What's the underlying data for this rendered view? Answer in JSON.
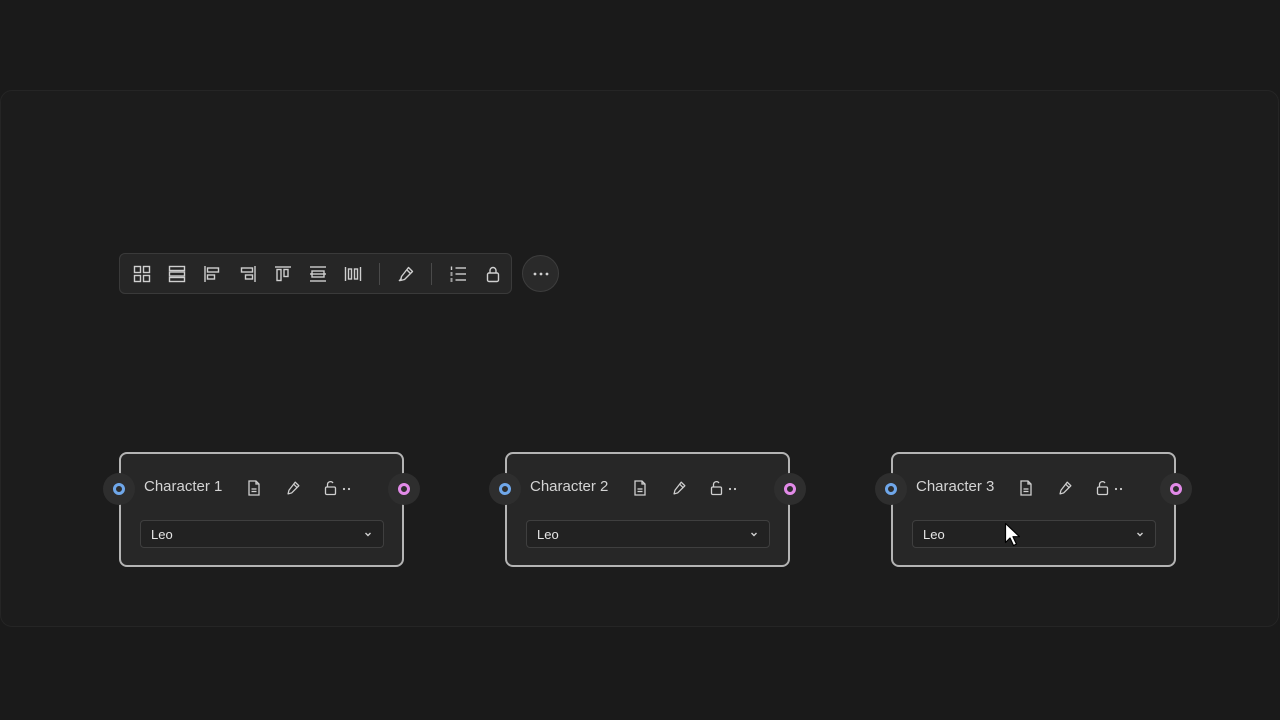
{
  "toolbar": {
    "buttons": [
      {
        "icon": "grid-icon"
      },
      {
        "icon": "rows-icon"
      },
      {
        "icon": "align-left-icon"
      },
      {
        "icon": "align-right-icon"
      },
      {
        "icon": "align-top-icon"
      },
      {
        "icon": "align-vertical-center-icon"
      },
      {
        "icon": "distribute-horizontal-icon"
      },
      {
        "icon": "pen-icon"
      },
      {
        "icon": "numbered-list-icon"
      },
      {
        "icon": "lock-icon"
      }
    ],
    "more_icon": "more-horizontal-icon"
  },
  "nodes": [
    {
      "title": "Character 1",
      "selected": "Leo"
    },
    {
      "title": "Character 2",
      "selected": "Leo"
    },
    {
      "title": "Character 3",
      "selected": "Leo"
    }
  ],
  "colors": {
    "port_input": "#6fa7ea",
    "port_output": "#e28ae8",
    "node_border": "#b4b4b4",
    "background": "#1c1c1c"
  }
}
